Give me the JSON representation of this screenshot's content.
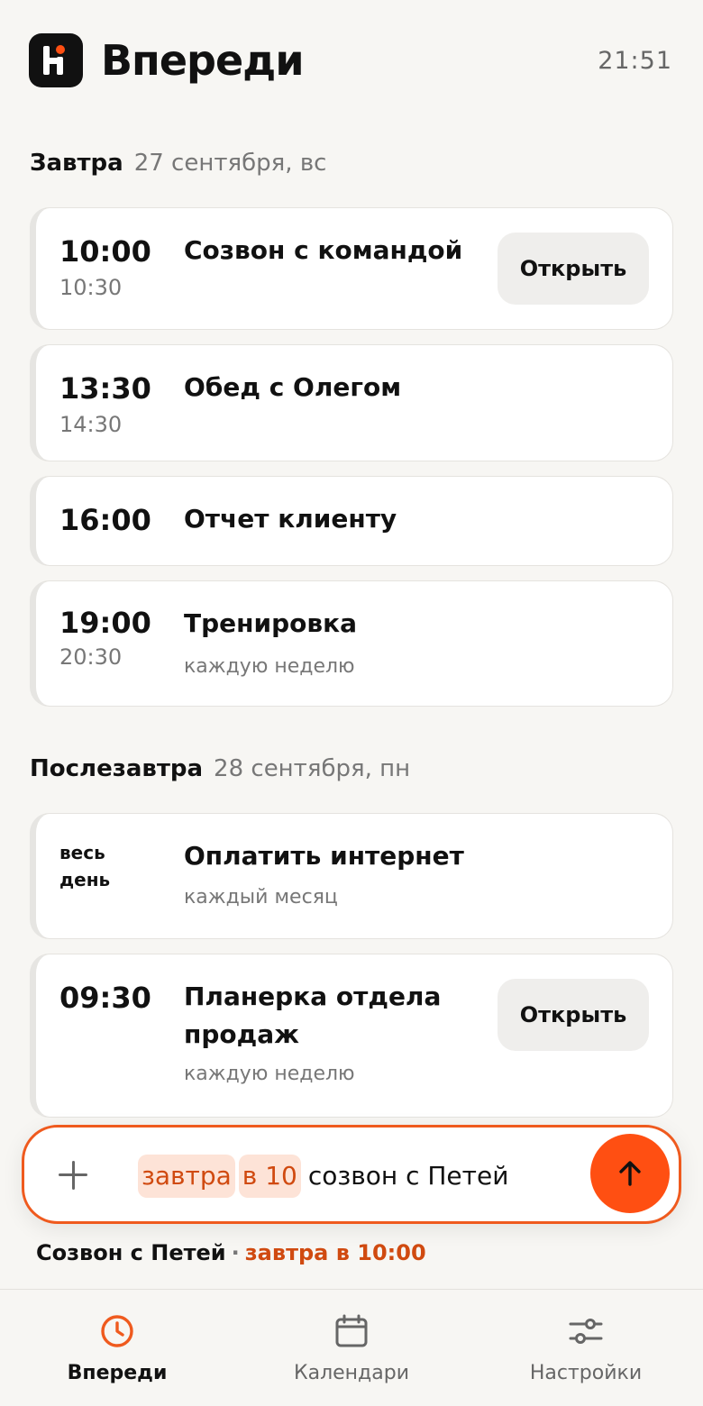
{
  "header": {
    "app_title": "Впереди",
    "clock": "21:51"
  },
  "sections": [
    {
      "label": "Завтра",
      "date": "27 сентября, вс"
    },
    {
      "label": "Послезавтра",
      "date": "28 сентября, пн"
    }
  ],
  "events": [
    {
      "start": "10:00",
      "end": "10:30",
      "title": "Созвон с командой",
      "open_label": "Открыть"
    },
    {
      "start": "13:30",
      "end": "14:30",
      "title": "Обед с Олегом"
    },
    {
      "start": "16:00",
      "title": "Отчет клиенту"
    },
    {
      "start": "19:00",
      "end": "20:30",
      "title": "Тренировка",
      "repeat": "каждую неделю"
    },
    {
      "allday_line1": "весь",
      "allday_line2": "день",
      "title": "Оплатить интернет",
      "repeat": "каждый месяц"
    },
    {
      "start": "09:30",
      "title": "Планерка отдела продаж",
      "repeat": "каждую неделю",
      "open_label": "Открыть"
    }
  ],
  "composer": {
    "token_day": "завтра",
    "token_time": "в 10",
    "rest_text": "созвон с Петей"
  },
  "parse_hint": {
    "title": "Созвон с Петей",
    "separator": "·",
    "when": "завтра в 10:00"
  },
  "nav": [
    {
      "label": "Впереди",
      "icon": "clock-icon",
      "active": true
    },
    {
      "label": "Календари",
      "icon": "calendar-icon",
      "active": false
    },
    {
      "label": "Настройки",
      "icon": "sliders-icon",
      "active": false
    }
  ],
  "colors": {
    "accent": "#ff4f12",
    "accent_text": "#d04a10",
    "chip_bg": "#fde3d7",
    "background": "#f7f6f3"
  }
}
